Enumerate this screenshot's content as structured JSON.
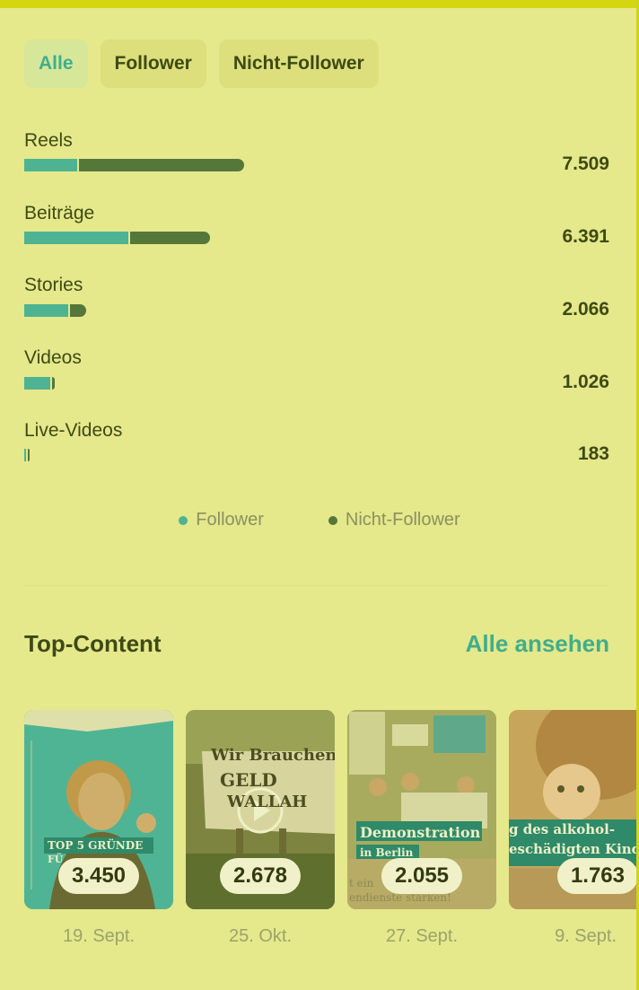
{
  "filters": {
    "tabs": [
      "Alle",
      "Follower",
      "Nicht-Follower"
    ],
    "active": "Alle"
  },
  "metrics": [
    {
      "label": "Reels",
      "value": "7.509",
      "follower_fraction": 0.24
    },
    {
      "label": "Beiträge",
      "value": "6.391",
      "follower_fraction": 0.56
    },
    {
      "label": "Stories",
      "value": "2.066",
      "follower_fraction": 0.71
    },
    {
      "label": "Videos",
      "value": "1.026",
      "follower_fraction": 0.85
    },
    {
      "label": "Live-Videos",
      "value": "183",
      "follower_fraction": 0.5
    }
  ],
  "legend": {
    "follower": "Follower",
    "non_follower": "Nicht-Follower"
  },
  "colors": {
    "follower": "#4db392",
    "non_follower": "#55773a",
    "accent": "#41ad8b"
  },
  "top_content": {
    "title": "Top-Content",
    "see_all": "Alle ansehen",
    "items": [
      {
        "value": "3.450",
        "date": "19. Sept.",
        "overlay": [
          "TOP 5 GRÜNDE",
          "FÜ"
        ]
      },
      {
        "value": "2.678",
        "date": "25. Okt.",
        "overlay": [
          "Wir Brauchen",
          "GELD",
          "WALLAH"
        ]
      },
      {
        "value": "2.055",
        "date": "27. Sept.",
        "overlay": [
          "Demonstration",
          "in Berlin",
          "t ein",
          "endienste stärken!"
        ]
      },
      {
        "value": "1.763",
        "date": "9. Sept.",
        "overlay": [
          "g des alkohol-",
          "eschädigten Kindes"
        ]
      }
    ]
  }
}
